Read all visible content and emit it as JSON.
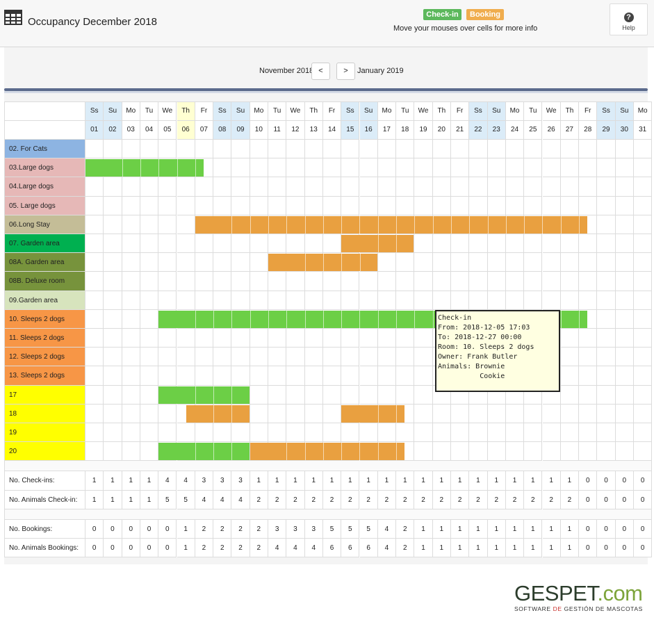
{
  "header": {
    "title": "Occupancy December 2018",
    "legend": {
      "checkin": "Check-in",
      "booking": "Booking"
    },
    "hint": "Move your mouses over cells for more info",
    "help_label": "Help",
    "help_glyph": "?"
  },
  "nav": {
    "prev_month": "November 2018",
    "next_month": "January 2019",
    "prev_glyph": "<",
    "next_glyph": ">"
  },
  "colors": {
    "checkin": "#6ccf46",
    "booking": "#e9a040",
    "weekend": "#dbecf8",
    "today": "#ffffd2"
  },
  "calendar": {
    "weekdays": [
      "Ss",
      "Su",
      "Mo",
      "Tu",
      "We",
      "Th",
      "Fr",
      "Ss",
      "Su",
      "Mo",
      "Tu",
      "We",
      "Th",
      "Fr",
      "Ss",
      "Su",
      "Mo",
      "Tu",
      "We",
      "Th",
      "Fr",
      "Ss",
      "Su",
      "Mo",
      "Tu",
      "We",
      "Th",
      "Fr",
      "Ss",
      "Su",
      "Mo"
    ],
    "days": [
      "01",
      "02",
      "03",
      "04",
      "05",
      "06",
      "07",
      "08",
      "09",
      "10",
      "11",
      "12",
      "13",
      "14",
      "15",
      "16",
      "17",
      "18",
      "19",
      "20",
      "21",
      "22",
      "23",
      "24",
      "25",
      "26",
      "27",
      "28",
      "29",
      "30",
      "31"
    ],
    "weekend_days": [
      1,
      2,
      8,
      9,
      15,
      16,
      22,
      23,
      29,
      30
    ],
    "today_day": 6
  },
  "rooms": [
    {
      "label": "02. For Cats",
      "color": "#8db4e2"
    },
    {
      "label": "03.Large dogs",
      "color": "#e6b8b7"
    },
    {
      "label": "04.Large dogs",
      "color": "#e6b8b7"
    },
    {
      "label": "05. Large dogs",
      "color": "#e6b8b7"
    },
    {
      "label": "06.Long Stay",
      "color": "#c4bd97"
    },
    {
      "label": "07. Garden area",
      "color": "#00b050"
    },
    {
      "label": "08A. Garden area",
      "color": "#77933c"
    },
    {
      "label": "08B. Deluxe room",
      "color": "#77933c"
    },
    {
      "label": "09.Garden area",
      "color": "#d7e4bd"
    },
    {
      "label": "10. Sleeps 2 dogs",
      "color": "#f79646"
    },
    {
      "label": "11. Sleeps 2 dogs",
      "color": "#f79646"
    },
    {
      "label": "12. Sleeps 2 dogs",
      "color": "#f79646"
    },
    {
      "label": "13. Sleeps 2 dogs",
      "color": "#f79646"
    },
    {
      "label": "17",
      "color": "#ffff00"
    },
    {
      "label": "18",
      "color": "#ffff00"
    },
    {
      "label": "19",
      "color": "#ffff00"
    },
    {
      "label": "20",
      "color": "#ffff00"
    }
  ],
  "stays": [
    {
      "room": 1,
      "start": 1,
      "end": 6.5,
      "type": "checkin"
    },
    {
      "room": 4,
      "start": 7,
      "end": 27.5,
      "type": "booking"
    },
    {
      "room": 5,
      "start": 15,
      "end": 18,
      "type": "booking"
    },
    {
      "room": 6,
      "start": 11,
      "end": 16,
      "type": "booking"
    },
    {
      "room": 9,
      "start": 5,
      "end": 27.5,
      "type": "checkin"
    },
    {
      "room": 13,
      "start": 5,
      "end": 9,
      "type": "checkin"
    },
    {
      "room": 14,
      "start": 6.5,
      "end": 9,
      "type": "booking"
    },
    {
      "room": 14,
      "start": 15,
      "end": 17.5,
      "type": "booking"
    },
    {
      "room": 16,
      "start": 5,
      "end": 9,
      "type": "checkin"
    },
    {
      "room": 16,
      "start": 10,
      "end": 17.5,
      "type": "booking"
    }
  ],
  "stats_checkins": [
    {
      "label": "No. Check-ins:",
      "values": [
        "1",
        "1",
        "1",
        "1",
        "4",
        "4",
        "3",
        "3",
        "3",
        "1",
        "1",
        "1",
        "1",
        "1",
        "1",
        "1",
        "1",
        "1",
        "1",
        "1",
        "1",
        "1",
        "1",
        "1",
        "1",
        "1",
        "1",
        "0",
        "0",
        "0",
        "0"
      ]
    },
    {
      "label": "No. Animals Check-in:",
      "values": [
        "1",
        "1",
        "1",
        "1",
        "5",
        "5",
        "4",
        "4",
        "4",
        "2",
        "2",
        "2",
        "2",
        "2",
        "2",
        "2",
        "2",
        "2",
        "2",
        "2",
        "2",
        "2",
        "2",
        "2",
        "2",
        "2",
        "2",
        "0",
        "0",
        "0",
        "0"
      ]
    }
  ],
  "stats_bookings": [
    {
      "label": "No. Bookings:",
      "values": [
        "0",
        "0",
        "0",
        "0",
        "0",
        "1",
        "2",
        "2",
        "2",
        "2",
        "3",
        "3",
        "3",
        "5",
        "5",
        "5",
        "4",
        "2",
        "1",
        "1",
        "1",
        "1",
        "1",
        "1",
        "1",
        "1",
        "1",
        "0",
        "0",
        "0",
        "0"
      ]
    },
    {
      "label": "No. Animals Bookings:",
      "values": [
        "0",
        "0",
        "0",
        "0",
        "0",
        "1",
        "2",
        "2",
        "2",
        "2",
        "4",
        "4",
        "4",
        "6",
        "6",
        "6",
        "4",
        "2",
        "1",
        "1",
        "1",
        "1",
        "1",
        "1",
        "1",
        "1",
        "1",
        "0",
        "0",
        "0",
        "0"
      ]
    }
  ],
  "tooltip": {
    "lines": [
      "Check-in",
      "From: 2018-12-05 17:03",
      "To: 2018-12-27 00:00",
      "Room: 10. Sleeps 2 dogs",
      "Owner: Frank Butler",
      "Animals: Brownie",
      "          Cookie"
    ]
  },
  "footer": {
    "brand_main": "GESPET",
    "brand_suffix": ".com",
    "tagline_a": "SOFTWARE ",
    "tagline_b": "DE",
    "tagline_c": " GESTIÓN DE MASCOTAS"
  }
}
